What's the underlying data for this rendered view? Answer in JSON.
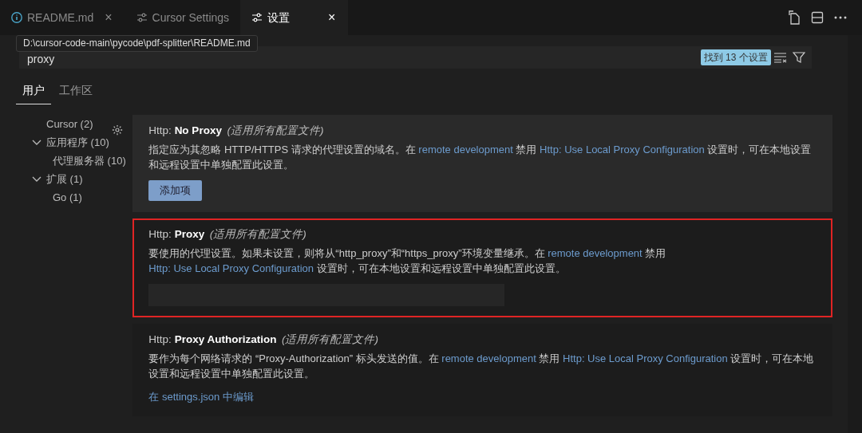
{
  "tabs": [
    {
      "label": "README.md",
      "selected": false,
      "close": "×"
    },
    {
      "label": "Cursor Settings",
      "selected": false
    },
    {
      "label": "设置",
      "selected": true,
      "close": "×"
    }
  ],
  "tooltip": "D:\\cursor-code-main\\pycode\\pdf-splitter\\README.md",
  "search": {
    "value": "proxy",
    "result_badge": "找到 13 个设置"
  },
  "scope_tabs": [
    {
      "label": "用户",
      "selected": true
    },
    {
      "label": "工作区",
      "selected": false
    }
  ],
  "toc": [
    {
      "label": "Cursor (2)"
    },
    {
      "label": "应用程序 (10)",
      "expanded": true,
      "children": [
        {
          "label": "代理服务器 (10)"
        }
      ]
    },
    {
      "label": "扩展 (1)",
      "expanded": true,
      "children": [
        {
          "label": "Go (1)"
        }
      ]
    }
  ],
  "settings": [
    {
      "category": "Http: ",
      "name": "No Proxy",
      "scope": "(适用所有配置文件)",
      "focused": true,
      "highlighted": false,
      "description": [
        {
          "kind": "text",
          "text": "指定应为其忽略 HTTP/HTTPS 请求的代理设置的域名。在 "
        },
        {
          "kind": "link",
          "text": "remote development"
        },
        {
          "kind": "text",
          "text": " 禁用 "
        },
        {
          "kind": "link",
          "text": "Http: Use Local Proxy Configuration"
        },
        {
          "kind": "text",
          "text": " 设置时，可在本地设置和远程设置中单独配置此设置。"
        }
      ],
      "control": {
        "kind": "button",
        "label": "添加项"
      }
    },
    {
      "category": "Http: ",
      "name": "Proxy",
      "scope": "(适用所有配置文件)",
      "focused": false,
      "highlighted": true,
      "description": [
        {
          "kind": "text",
          "text": "要使用的代理设置。如果未设置，则将从“http_proxy”和“https_proxy”环境变量继承。在 "
        },
        {
          "kind": "link",
          "text": "remote development"
        },
        {
          "kind": "text",
          "text": " 禁用 "
        },
        {
          "kind": "link",
          "text": "Http: Use Local Proxy Configuration"
        },
        {
          "kind": "text",
          "text": " 设置时，可在本地设置和远程设置中单独配置此设置。"
        }
      ],
      "control": {
        "kind": "input"
      }
    },
    {
      "category": "Http: ",
      "name": "Proxy Authorization",
      "scope": "(适用所有配置文件)",
      "focused": false,
      "highlighted": false,
      "description": [
        {
          "kind": "text",
          "text": "要作为每个网络请求的 “Proxy-Authorization” 标头发送的值。在 "
        },
        {
          "kind": "link",
          "text": "remote development"
        },
        {
          "kind": "text",
          "text": " 禁用 "
        },
        {
          "kind": "link",
          "text": "Http: Use Local Proxy Configuration"
        },
        {
          "kind": "text",
          "text": " 设置时，可在本地设置和远程设置中单独配置此设置。"
        }
      ],
      "control": {
        "kind": "link",
        "label": "在 settings.json 中编辑"
      }
    }
  ]
}
